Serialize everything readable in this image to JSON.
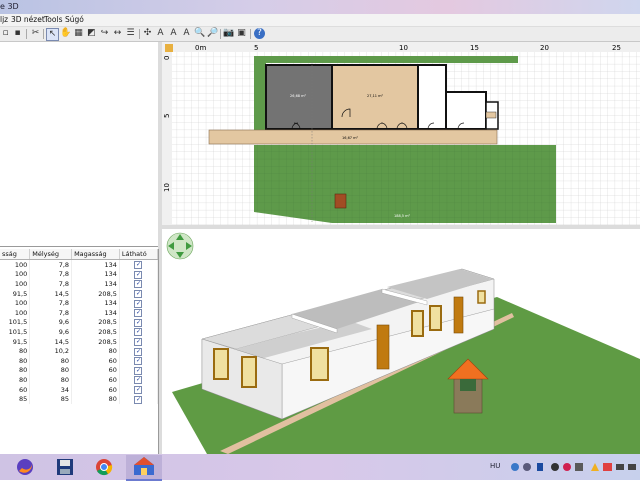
{
  "window": {
    "title_fragment": "e 3D"
  },
  "menu": {
    "items": [
      "ljz",
      "3D nézet",
      "Tools",
      "Súgó"
    ]
  },
  "toolbar": {
    "icons": [
      "new-icon",
      "save-icon",
      "cut-icon",
      "select-arrow-icon",
      "pan-hand-icon",
      "create-walls-icon",
      "create-rooms-icon",
      "create-dimensions-icon",
      "add-text-icon",
      "text-style-icon",
      "zoom-in-icon",
      "zoom-out-icon",
      "photo-icon",
      "video-icon",
      "help-icon"
    ]
  },
  "plan": {
    "ruler_top": [
      "0m",
      "5",
      "10",
      "15",
      "20",
      "25"
    ],
    "ruler_left": [
      "0",
      "5",
      "10"
    ],
    "room_labels": {
      "room1": "26,68 m²",
      "room2": "27,11 m²",
      "terrace": "16,67 m²",
      "garden": "188,5 m²"
    }
  },
  "furniture_table": {
    "headers": [
      "sság",
      "Mélység",
      "Magasság",
      "Látható"
    ],
    "rows": [
      [
        "100",
        "7,8",
        "134",
        "✓"
      ],
      [
        "100",
        "7,8",
        "134",
        "✓"
      ],
      [
        "100",
        "7,8",
        "134",
        "✓"
      ],
      [
        "91,5",
        "14,5",
        "208,5",
        "✓"
      ],
      [
        "100",
        "7,8",
        "134",
        "✓"
      ],
      [
        "100",
        "7,8",
        "134",
        "✓"
      ],
      [
        "101,5",
        "9,6",
        "208,5",
        "✓"
      ],
      [
        "101,5",
        "9,6",
        "208,5",
        "✓"
      ],
      [
        "91,5",
        "14,5",
        "208,5",
        "✓"
      ],
      [
        "80",
        "10,2",
        "80",
        "✓"
      ],
      [
        "80",
        "80",
        "60",
        "✓"
      ],
      [
        "80",
        "80",
        "60",
        "✓"
      ],
      [
        "80",
        "80",
        "60",
        "✓"
      ],
      [
        "60",
        "34",
        "60",
        "✓"
      ],
      [
        "85",
        "85",
        "80",
        "✓"
      ]
    ]
  },
  "taskbar": {
    "apps": [
      "firefox-icon",
      "save-app-icon",
      "chrome-icon",
      "sweet-home-3d-icon"
    ],
    "language": "HU"
  },
  "colors": {
    "grass": "#5e9a4a",
    "wood": "#e8c9a4",
    "wall_dark": "#707070"
  }
}
